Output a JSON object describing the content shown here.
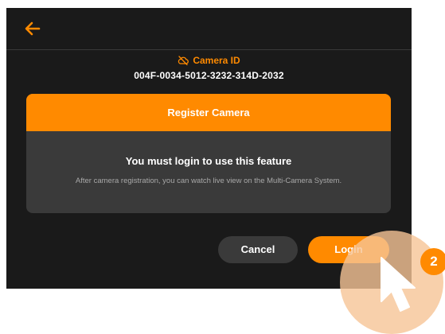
{
  "header": {
    "back_icon": "arrow-left-icon",
    "accent_color": "#ff8a00"
  },
  "camera": {
    "status_icon": "cloud-offline-icon",
    "label": "Camera ID",
    "serial": "004F-0034-5012-3232-314D-2032"
  },
  "dialog": {
    "header_title": "Register Camera",
    "message_title": "You must login to use this feature",
    "message_desc": "After camera registration, you can watch live view on the Multi-Camera System."
  },
  "buttons": {
    "cancel_label": "Cancel",
    "login_label": "Login"
  },
  "annotation": {
    "step_number": "2",
    "pointer_icon": "mouse-pointer-icon"
  }
}
